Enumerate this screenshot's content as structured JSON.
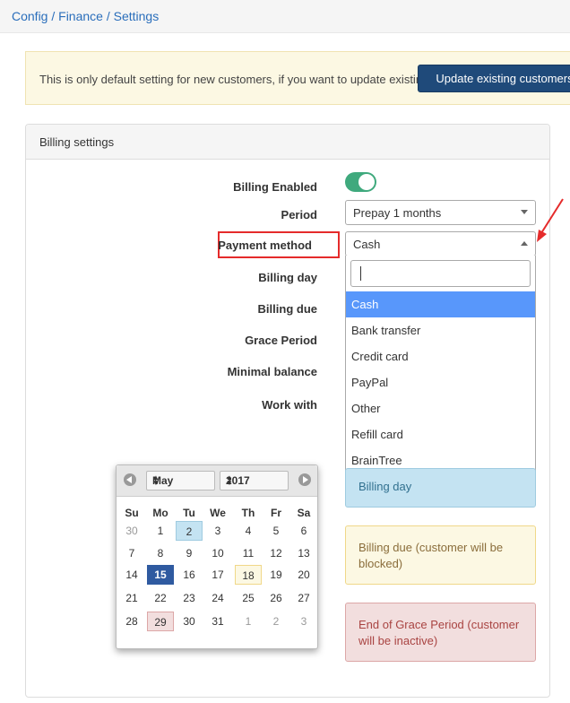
{
  "breadcrumb": "Config / Finance / Settings",
  "alert": {
    "text": "This is only default setting for new customers, if you want to update existing:",
    "button": "Update existing customers"
  },
  "panel": {
    "title": "Billing settings"
  },
  "fields": {
    "billing_enabled": "Billing Enabled",
    "period": "Period",
    "payment_method": "Payment method",
    "billing_day": "Billing day",
    "billing_due": "Billing due",
    "grace_period": "Grace Period",
    "minimal_balance": "Minimal balance",
    "work_with": "Work with"
  },
  "billing_enabled_on": true,
  "period_value": "Prepay 1 months",
  "payment_method_value": "Cash",
  "payment_options": [
    "Cash",
    "Bank transfer",
    "Credit card",
    "PayPal",
    "Other",
    "Refill card",
    "BrainTree"
  ],
  "legend": {
    "billing_day": "Billing day",
    "billing_due": "Billing due (customer will be blocked)",
    "end_grace": "End of Grace Period (customer will be inactive)"
  },
  "calendar": {
    "month": "May",
    "year": "2017",
    "weekdays": [
      "Su",
      "Mo",
      "Tu",
      "We",
      "Th",
      "Fr",
      "Sa"
    ],
    "weeks": [
      [
        "30",
        "1",
        "2",
        "3",
        "4",
        "5",
        "6"
      ],
      [
        "7",
        "8",
        "9",
        "10",
        "11",
        "12",
        "13"
      ],
      [
        "14",
        "15",
        "16",
        "17",
        "18",
        "19",
        "20"
      ],
      [
        "21",
        "22",
        "23",
        "24",
        "25",
        "26",
        "27"
      ],
      [
        "28",
        "29",
        "30",
        "31",
        "1",
        "2",
        "3"
      ]
    ]
  },
  "colors": {
    "accent": "#2f5aa0",
    "highlight": "#5897fb",
    "annotation": "#e52b2b"
  }
}
